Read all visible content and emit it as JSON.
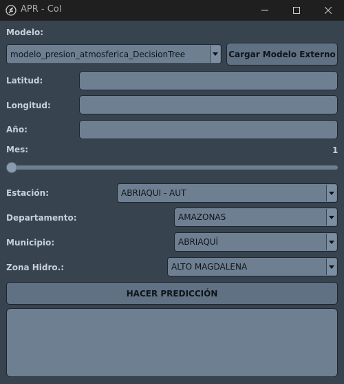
{
  "window": {
    "title": "APR - Col"
  },
  "labels": {
    "modelo": "Modelo:",
    "latitud": "Latitud:",
    "longitud": "Longitud:",
    "anio": "Año:",
    "mes": "Mes:",
    "estacion": "Estación:",
    "departamento": "Departamento:",
    "municipio": "Municipio:",
    "zona": "Zona Hidro.:"
  },
  "model_select": {
    "value": "modelo_presion_atmosferica_DecisionTree"
  },
  "load_button": {
    "label": "Cargar Modelo Externo"
  },
  "inputs": {
    "latitud": "",
    "longitud": "",
    "anio": ""
  },
  "mes_slider": {
    "value": "1",
    "min": 1,
    "max": 12
  },
  "estacion_select": {
    "value": "ABRIAQUI - AUT"
  },
  "departamento_select": {
    "value": "AMAZONAS"
  },
  "municipio_select": {
    "value": "ABRIAQUÍ"
  },
  "zona_select": {
    "value": "ALTO MAGDALENA"
  },
  "predict_button": {
    "label": "HACER PREDICCIÓN"
  },
  "output": {
    "text": ""
  },
  "icons": {
    "app": "feather-icon",
    "min": "minimize-icon",
    "max": "maximize-icon",
    "close": "close-icon",
    "dropdown": "chevron-down-icon"
  },
  "colors": {
    "titlebar": "#1f1f1f",
    "window": "#37434f",
    "field": "#6e7f92",
    "button": "#607183"
  }
}
